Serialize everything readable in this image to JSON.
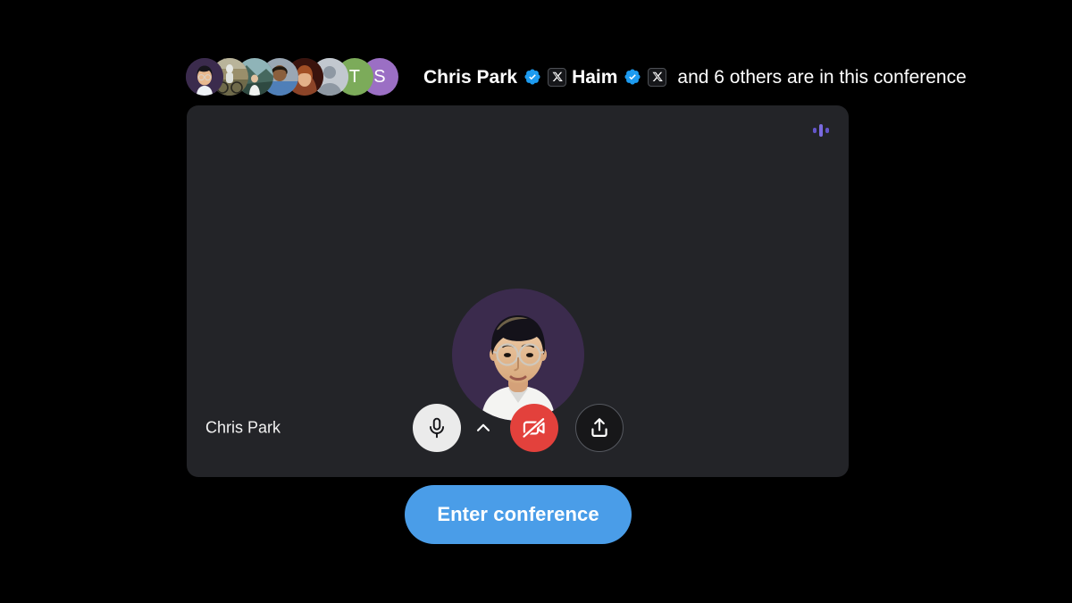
{
  "page": {
    "background_color": "#000000"
  },
  "header": {
    "participants_avatars": [
      {
        "name": "chris-park",
        "type": "photo",
        "label": "",
        "bg": "#3b2b4d"
      },
      {
        "name": "participant-cyclist",
        "type": "photo",
        "label": "",
        "bg": "#8a8a63"
      },
      {
        "name": "participant-hiker",
        "type": "photo",
        "label": "",
        "bg": "#5d7d7a"
      },
      {
        "name": "participant-blue-shirt",
        "type": "photo",
        "label": "",
        "bg": "#6b7f9e"
      },
      {
        "name": "participant-auburn",
        "type": "photo",
        "label": "",
        "bg": "#4a1f16"
      },
      {
        "name": "participant-default",
        "type": "silhouette",
        "label": "",
        "bg": "#b8bec6"
      },
      {
        "name": "participant-t",
        "type": "initial",
        "label": "T",
        "bg": "#7cab5a"
      },
      {
        "name": "participant-s",
        "type": "initial",
        "label": "S",
        "bg": "#9b6fc4"
      }
    ],
    "name_first": "Chris Park",
    "name_second": "Haim",
    "suffix_text": "and 6 others are in this conference",
    "verified_badge_color": "#1d9bf0",
    "x_badge_glyph": "X"
  },
  "video_card": {
    "background_color": "#232428",
    "audio_meter": {
      "name": "audio-level-meter",
      "bars": [
        6,
        14,
        6
      ],
      "color": "#6c5ce7"
    },
    "self_avatar": {
      "name": "chris-park-avatar",
      "background_color": "#3b2b4d"
    },
    "self_name": "Chris Park",
    "controls": {
      "mic": {
        "label": "Microphone",
        "state": "on",
        "background": "#ebebeb"
      },
      "mic_expand": {
        "label": "Audio settings",
        "icon": "chevron-up-icon"
      },
      "camera": {
        "label": "Camera off",
        "state": "off",
        "background": "#e3413c"
      },
      "share": {
        "label": "Share screen",
        "background": "#171719"
      }
    }
  },
  "enter_button": {
    "label": "Enter conference",
    "background_color": "#4a9de8"
  }
}
